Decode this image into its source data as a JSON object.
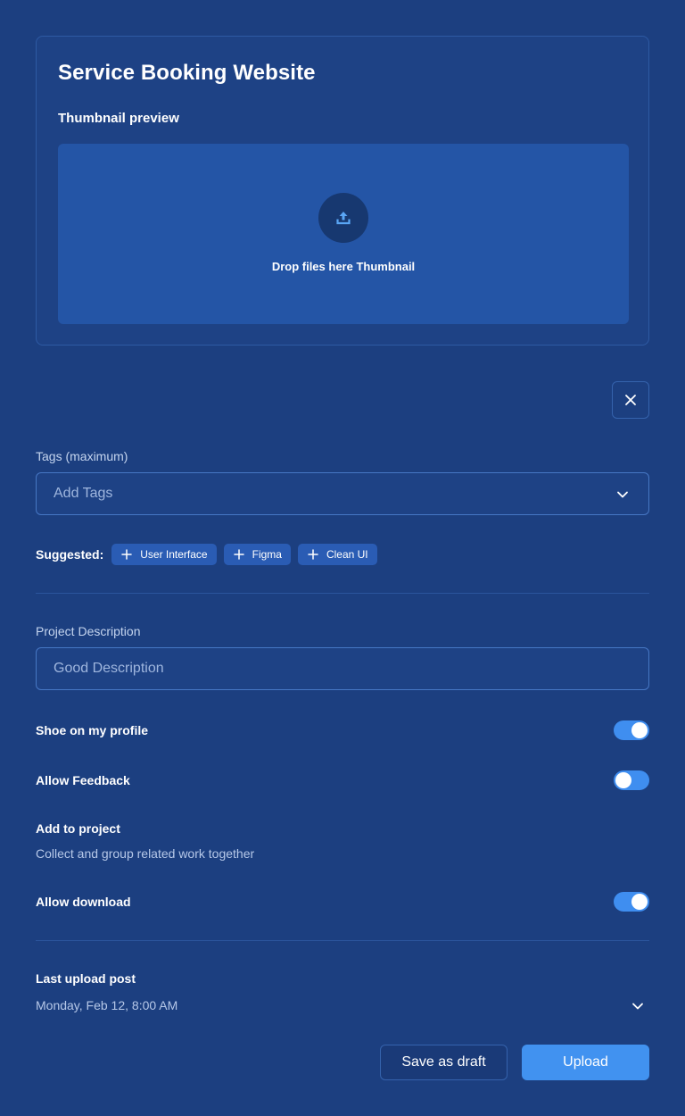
{
  "card": {
    "title": "Service Booking Website",
    "thumbnail_label": "Thumbnail preview",
    "dropzone_text": "Drop files here Thumbnail",
    "upload_icon": "upload-icon"
  },
  "close_icon": "close-icon",
  "tags": {
    "label": "Tags (maximum)",
    "placeholder": "Add Tags",
    "chevron_icon": "chevron-down-icon",
    "suggested_label": "Suggested:",
    "suggestions": [
      "User Interface",
      "Figma",
      "Clean UI"
    ]
  },
  "description": {
    "label": "Project Description",
    "placeholder": "Good Description"
  },
  "settings": {
    "show_on_profile": {
      "label": "Shoe on my profile",
      "enabled": true
    },
    "allow_feedback": {
      "label": "Allow Feedback",
      "enabled": false
    },
    "add_to_project": {
      "label": "Add to project",
      "sublabel": "Collect and group related work together"
    },
    "allow_download": {
      "label": "Allow download",
      "enabled": true
    }
  },
  "last_upload": {
    "label": "Last upload post",
    "value": "Monday, Feb 12, 8:00 AM"
  },
  "actions": {
    "draft_label": "Save as draft",
    "upload_label": "Upload"
  },
  "colors": {
    "background": "#1c3f80",
    "dropzone": "#2455a6",
    "accent": "#4192f0",
    "chip": "#2a5cb4"
  }
}
